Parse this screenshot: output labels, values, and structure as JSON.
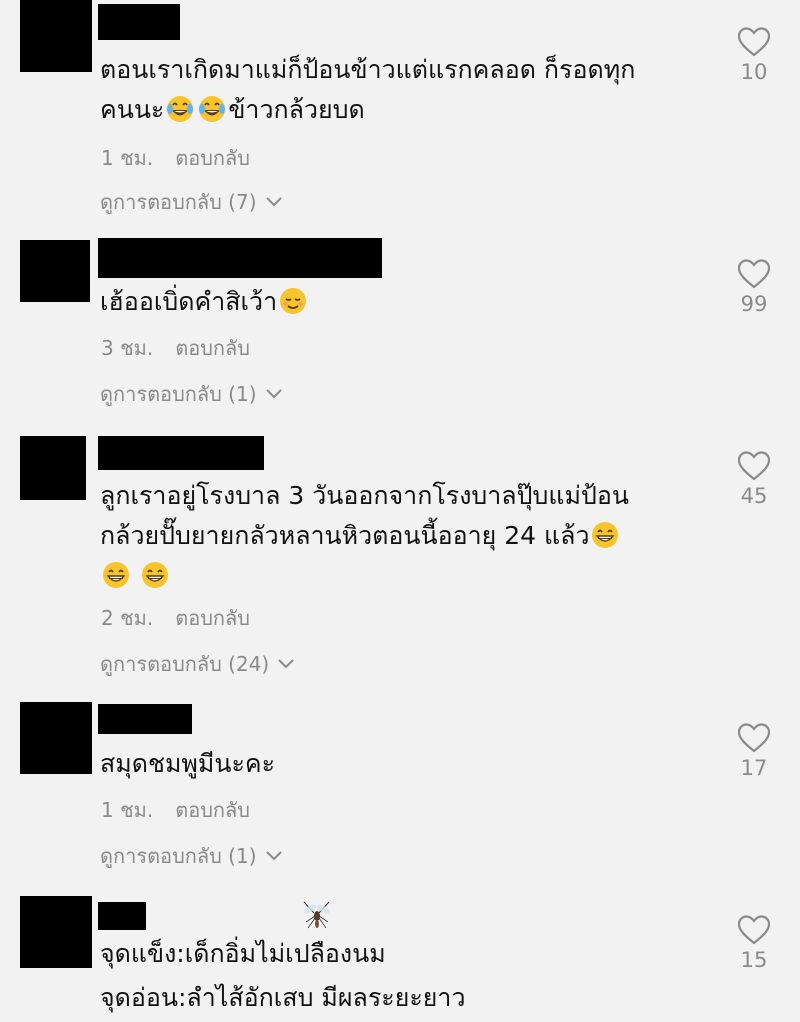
{
  "comments": [
    {
      "text_line1": "ตอนเราเกิดมาแม่ก็ป้อนข้าวแต่แรกคลอด ก็รอดทุก",
      "text_line2_prefix": "คนนะ",
      "text_line2_suffix": "ข้าวกล้วยบด",
      "time": "1 ชม.",
      "reply": "ตอบกลับ",
      "view_replies": "ดูการตอบกลับ (7)",
      "likes": "10"
    },
    {
      "text_line1": "เฮ้ออเบิ่ดคำสิเว้า",
      "time": "3 ชม.",
      "reply": "ตอบกลับ",
      "view_replies": "ดูการตอบกลับ (1)",
      "likes": "99"
    },
    {
      "text_line1": "ลูกเราอยู่โรงบาล 3 วันออกจากโรงบาลปุ๊บแม่ป้อน",
      "text_line2": "กล้วยปั๊บยายกลัวหลานหิวตอนนี้ออายุ 24 แล้ว",
      "time": "2 ชม.",
      "reply": "ตอบกลับ",
      "view_replies": "ดูการตอบกลับ (24)",
      "likes": "45"
    },
    {
      "text_line1": "สมุดชมพูมีนะคะ",
      "time": "1 ชม.",
      "reply": "ตอบกลับ",
      "view_replies": "ดูการตอบกลับ (1)",
      "likes": "17"
    },
    {
      "text_line1": "จุดแข็ง:เด็กอิ่มไม่เปลืองนม",
      "text_line2": "จุดอ่อน:ลำไส้อักเสบ มีผลระยะยาว",
      "likes": "15"
    }
  ],
  "icons": {
    "like": "heart-outline-icon",
    "chevron": "chevron-down-icon",
    "emoji_laugh": "face-with-tears-of-joy-icon",
    "emoji_relieved": "relieved-face-icon",
    "emoji_grin": "grinning-face-icon",
    "mosquito": "mosquito-icon"
  },
  "colors": {
    "background": "#f2f2f2",
    "text": "#111111",
    "muted": "#8a8a8a",
    "redaction": "#000000"
  }
}
